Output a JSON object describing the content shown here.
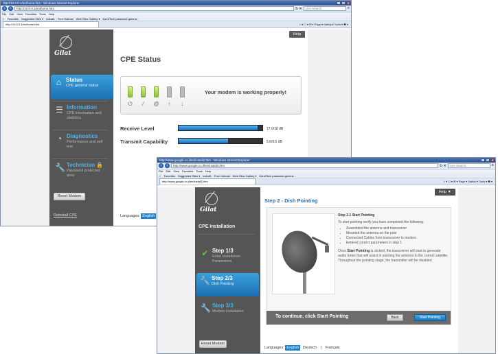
{
  "back_window": {
    "title": "http://10.0.0.1/en/home.htm - Windows Internet Explorer",
    "address": "http://10.0.0.1/en/home.htm",
    "search_placeholder": "Live Search",
    "menu": [
      "File",
      "Edit",
      "View",
      "Favorites",
      "Tools",
      "Help"
    ],
    "favorites": [
      "Favorites",
      "Suggested Sites ▾",
      "install1",
      "Free Hotmail",
      "Web Slice Gallery ▾",
      "KandTech password genera..."
    ],
    "tab_title": "http://10.0.0.1/en/home.htm",
    "cmd_bar": "⌂ ▾ ☐ ▾ ✉ ▾ Page ▾ Safety ▾ Tools ▾ ❷ ▾",
    "help_label": "Help",
    "page_title": "CPE Status",
    "nav": [
      {
        "title": "Status",
        "sub": "CPE general status"
      },
      {
        "title": "Information",
        "sub": "CPE information and statistics"
      },
      {
        "title": "Diagnostics",
        "sub": "Performance and self test"
      },
      {
        "title": "Technician 🔒",
        "sub": "Password protected area"
      }
    ],
    "reset_label": "Reset Modem",
    "install_link": "Reinstall CPE",
    "modem_message": "Your modem is working properly!",
    "leds": [
      "on",
      "on",
      "on",
      "off",
      "off"
    ],
    "levels": [
      {
        "label": "Receive Level",
        "value_text": "17.0/18 dB",
        "fraction": 0.94
      },
      {
        "label": "Transmit Capability",
        "value_text": "5.6/9.5 dB",
        "fraction": 0.59
      }
    ],
    "languages_label": "Languages:",
    "language_selected": "English"
  },
  "front_window": {
    "title": "http://www.google.co.il/en/install2.htm - Windows Internet Explorer",
    "address": "http://www.google.co.il/en/install2.htm",
    "search_placeholder": "Live Search",
    "menu": [
      "File",
      "Edit",
      "View",
      "Favorites",
      "Tools",
      "Help"
    ],
    "favorites": [
      "Favorites",
      "Suggested Sites ▾",
      "install1",
      "Free Hotmail",
      "Web Slice Gallery ▾",
      "KandTech password genera..."
    ],
    "tab_title": "http://www.google.co.il/en/install2.htm",
    "cmd_bar": "⌂ ▾ ☐ ▾ ✉ ▾ Page ▾ Safety ▾ Tools ▾ ❷ ▾",
    "help_label": "Help ▼",
    "section_title": "CPE Installation",
    "steps": [
      {
        "title": "Step 1/3",
        "sub": "Enter Installation Parameters",
        "state": "done"
      },
      {
        "title": "Step 2/3",
        "sub": "Dish Pointing",
        "state": "active"
      },
      {
        "title": "Step 3/3",
        "sub": "Modem installation",
        "state": "todo"
      }
    ],
    "reset_label": "Reset Modem",
    "page_title": "Step 2 - Dish Pointing",
    "sub_title": "Step 2.1 Start Pointing",
    "intro": "To start pointing verify you have completed the following:",
    "checklist": [
      "Assembled the antenna and transceiver",
      "Mounted the antenna on the pole",
      "Connected Cables from transceiver to modem",
      "Entered correct parameters in step 1"
    ],
    "desc_prefix": "Once ",
    "desc_bold": "Start Pointing",
    "desc_rest": " is clicked, the transceiver will start to generate audio tones that will assist in pointing the antenna to the correct satellite. Throughout the pointing stage, the transmitter will be disabled.",
    "footer_text": "To continue, click Start Pointing",
    "back_label": "Back",
    "start_label": "Start Pointing",
    "languages_label": "Languages:",
    "languages": [
      "English",
      "Deutsch",
      "|",
      "Français"
    ]
  }
}
